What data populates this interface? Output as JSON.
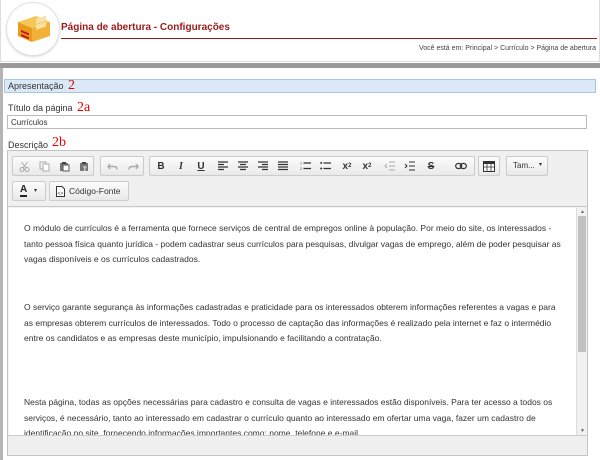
{
  "header": {
    "title": "Página de abertura - Configurações",
    "breadcrumb": "Você está em: Principal > Currículo > Página de abertura"
  },
  "annotations": {
    "section": "2",
    "title_field": "2a",
    "description_field": "2b"
  },
  "section": {
    "label": "Apresentação"
  },
  "form": {
    "title_label": "Título da página",
    "title_value": "Currículos",
    "description_label": "Descrição"
  },
  "toolbar": {
    "font_size_label": "Tam...",
    "source_label": "Código-Fonte",
    "text_color_glyph": "A",
    "buttons_row1": [
      "cut-icon",
      "copy-icon",
      "paste-icon",
      "paste-text-icon",
      "undo-icon",
      "redo-icon",
      "bold-icon",
      "italic-icon",
      "underline-icon",
      "align-left-icon",
      "align-center-icon",
      "align-right-icon",
      "align-justify-icon",
      "numbered-list-icon",
      "bulleted-list-icon",
      "subscript-icon",
      "superscript-icon",
      "outdent-icon",
      "indent-icon",
      "strikethrough-icon",
      "link-icon",
      "table-icon"
    ]
  },
  "content": {
    "paragraphs": [
      "O módulo de currículos é a ferramenta que fornece serviços de central de empregos online à população. Por meio do site, os interessados - tanto pessoa física quanto jurídica - podem cadastrar seus currículos para pesquisas, divulgar vagas de emprego, além de poder pesquisar as vagas disponíveis e os currículos cadastrados.",
      "O serviço garante segurança às informações cadastradas e praticidade para os interessados obterem informações referentes a vagas e para as empresas obterem currículos de interessados. Todo o processo de captação das informações é realizado pela internet e faz o intermédio entre os candidatos e as empresas deste município, impulsionando e facilitando a contratação.",
      "Nesta página, todas as opções necessárias para cadastro e consulta de vagas e interessados estão disponíveis. Para ter acesso a todos os serviços, é necessário, tanto ao interessado em cadastrar o currículo quanto ao interessado em ofertar uma vaga, fazer um cadastro de identificação no site, fornecendo informações importantes como: nome, telefone e e-mail."
    ]
  },
  "colors": {
    "accent": "#9a1b1b",
    "section_bg": "#dbe9f7",
    "annotation": "#e00000"
  }
}
